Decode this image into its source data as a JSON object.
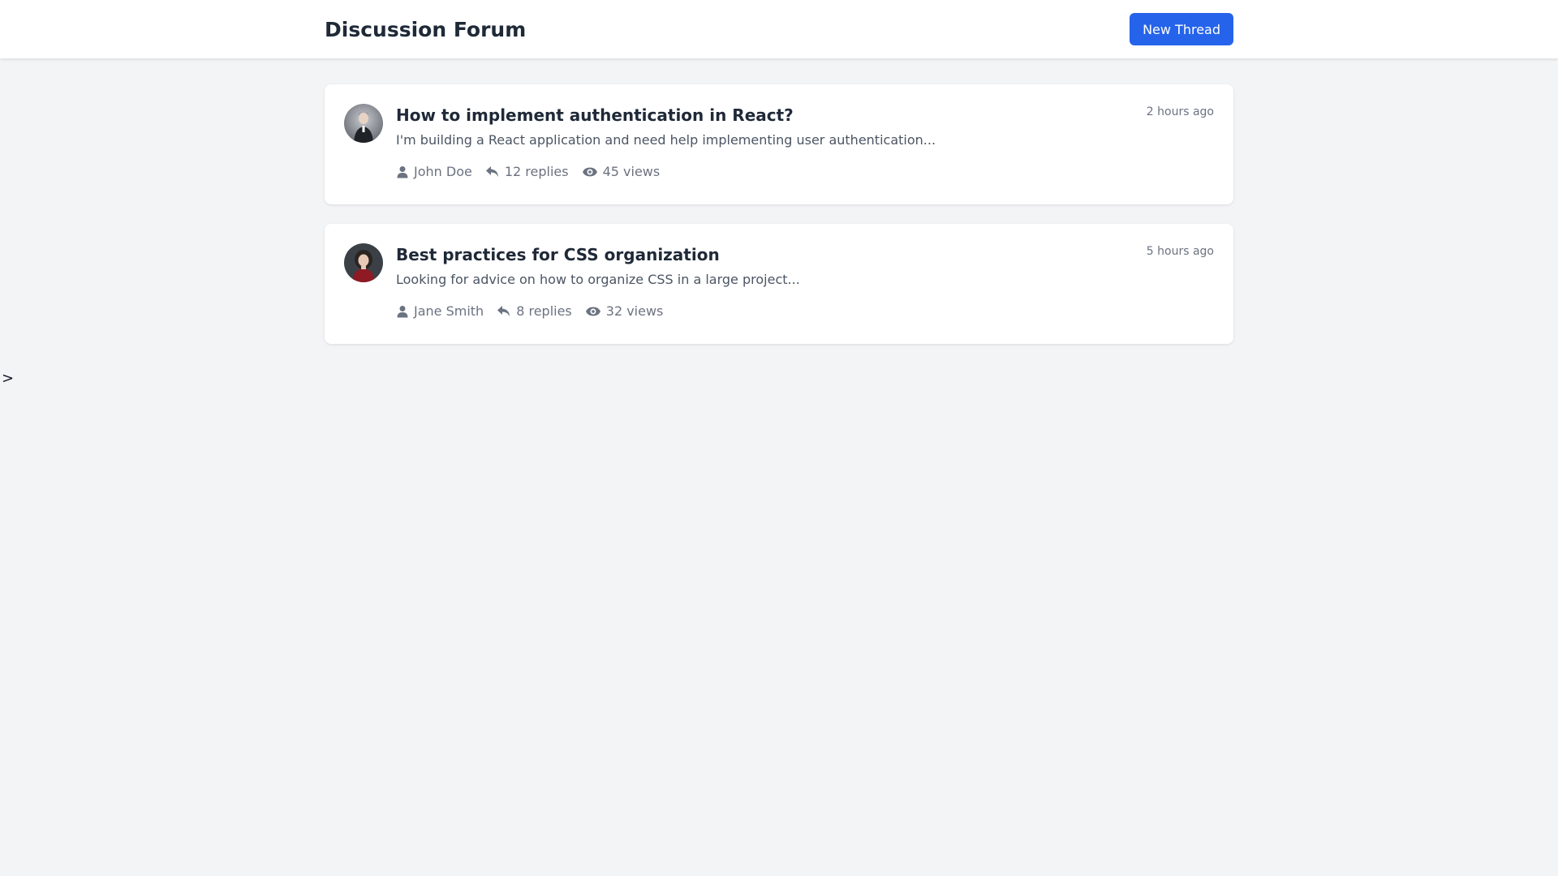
{
  "header": {
    "title": "Discussion Forum",
    "new_thread_label": "New Thread"
  },
  "colors": {
    "accent": "#2563eb",
    "page_bg": "#f3f4f6",
    "card_bg": "#ffffff",
    "muted_text": "#6b7280"
  },
  "threads": [
    {
      "title": "How to implement authentication in React?",
      "excerpt": "I'm building a React application and need help implementing user authentication...",
      "author": "John Doe",
      "replies": "12 replies",
      "views": "45 views",
      "time": "2 hours ago",
      "avatar_icon": "user-avatar-photo"
    },
    {
      "title": "Best practices for CSS organization",
      "excerpt": "Looking for advice on how to organize CSS in a large project...",
      "author": "Jane Smith",
      "replies": "8 replies",
      "views": "32 views",
      "time": "5 hours ago",
      "avatar_icon": "user-avatar-photo"
    }
  ],
  "icons": {
    "author": "user-icon",
    "replies": "reply-icon",
    "views": "eye-icon"
  },
  "stray_text": ">"
}
